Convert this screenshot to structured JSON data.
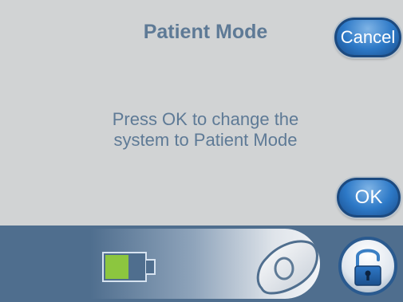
{
  "dialog": {
    "title": "Patient Mode",
    "message_line1": "Press OK to change the",
    "message_line2": "system to Patient Mode"
  },
  "buttons": {
    "cancel_label": "Cancel",
    "ok_label": "OK"
  },
  "status_bar": {
    "battery_level": 0.55,
    "battery_fill_color": "#8cc63f",
    "slider_handle_icon": "unlock-slider-handle-icon",
    "lock_button_icon": "unlocked-padlock-icon"
  },
  "colors": {
    "background": "#d1d3d4",
    "text": "#5e7a96",
    "button_blue": "#2d79c7",
    "bar": "#4f6e8e"
  }
}
